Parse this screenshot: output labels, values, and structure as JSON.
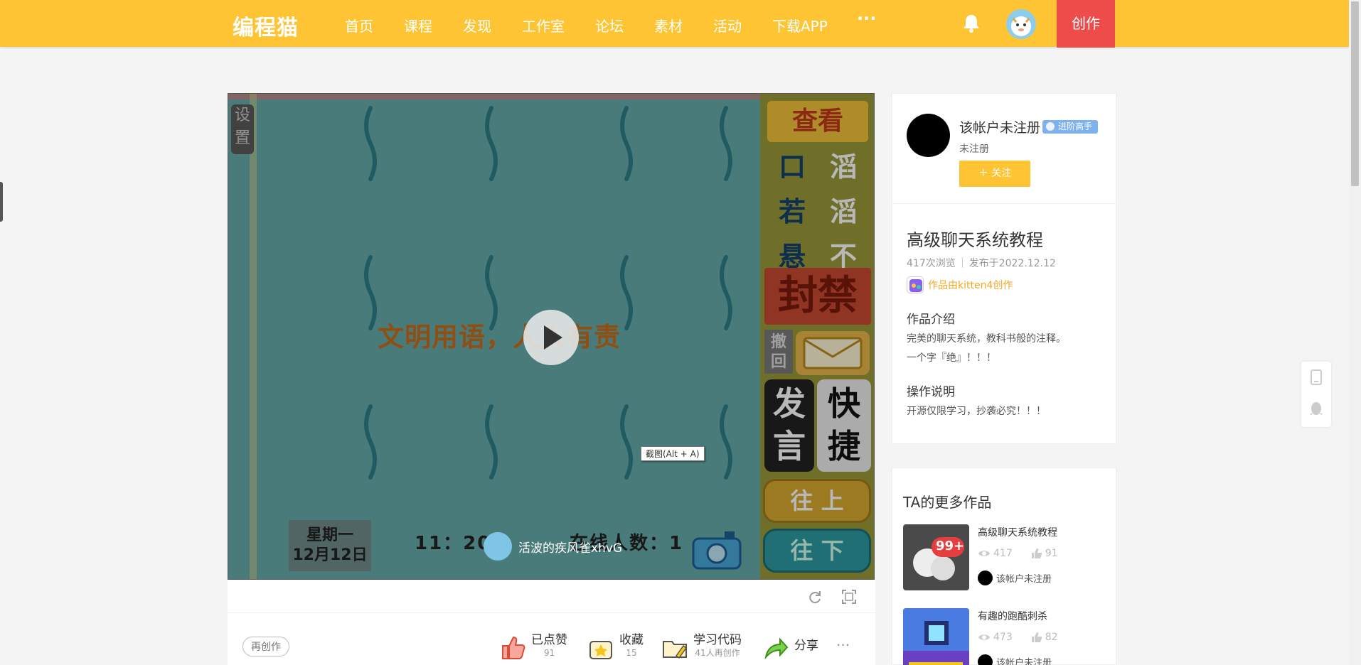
{
  "nav": {
    "logo": "编程猫",
    "items": [
      "首页",
      "课程",
      "发现",
      "工作室",
      "论坛",
      "素材",
      "活动",
      "下载APP"
    ],
    "more": "···",
    "create": "创作"
  },
  "player": {
    "settings": "设置",
    "slogan": "文明用语，人人有责",
    "panel": {
      "view": "查看",
      "quick_phrases": [
        "口",
        "滔",
        "若",
        "滔",
        "悬",
        "不"
      ],
      "ban": "封禁",
      "withdraw": "撤回",
      "speak": "发言",
      "shortcut": "快捷",
      "up": "往 上",
      "down": "往 下"
    },
    "weekday": "星期一",
    "date": "12月12日",
    "time": "11：20",
    "online": "在线人数：1",
    "author_name": "活波的疾风雀xhvG",
    "tooltip": "截图(Alt + A)"
  },
  "actions": {
    "remix": "再创作",
    "liked": "已点赞",
    "liked_count": "91",
    "favorite": "收藏",
    "favorite_count": "15",
    "learn": "学习代码",
    "learn_sub": "41人再创作",
    "share": "分享",
    "more": "···"
  },
  "author": {
    "name": "该帐户未注册",
    "badge": "进阶高手",
    "status": "未注册",
    "follow": "关注"
  },
  "work": {
    "title": "高级聊天系统教程",
    "views": "417次浏览",
    "published": "发布于2022.12.12",
    "made_with": "作品由kitten4创作",
    "intro_heading": "作品介绍",
    "intro_lines": [
      "完美的聊天系统，教科书般的注释。",
      "一个字『绝』！！！"
    ],
    "howto_heading": "操作说明",
    "howto_text": "开源仅限学习，抄袭必究！！！"
  },
  "more_works": {
    "heading": "TA的更多作品",
    "items": [
      {
        "title": "高级聊天系统教程",
        "views": "417",
        "likes": "91",
        "author": "该帐户未注册",
        "badge": "99+"
      },
      {
        "title": "有趣的跑酷刺杀",
        "views": "473",
        "likes": "82",
        "author": "该帐户未注册"
      }
    ]
  },
  "colors": {
    "brand": "#fec433",
    "create_button": "#ee4b4b",
    "badge": "#7db1ef",
    "made_with": "#f5a623"
  }
}
